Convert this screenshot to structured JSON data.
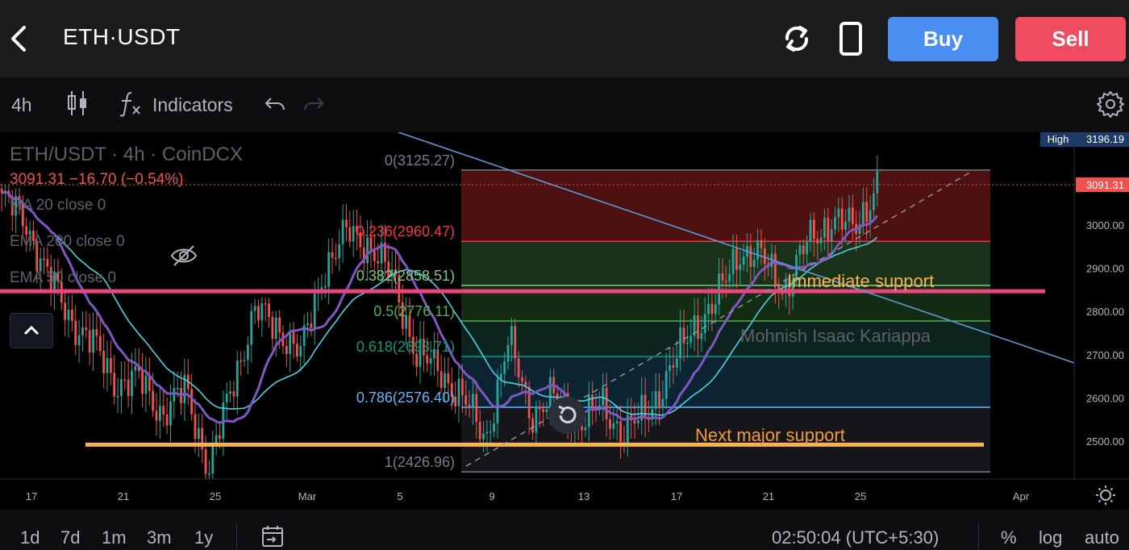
{
  "header": {
    "pair": "ETH·USDT",
    "buy_label": "Buy",
    "sell_label": "Sell"
  },
  "toolbar": {
    "interval": "4h",
    "indicators_label": "Indicators"
  },
  "legend": {
    "title": "ETH/USDT · 4h · CoinDCX",
    "price_line": "3091.31  −16.70 (−0.54%)",
    "indicators": [
      "MA 20 close 0",
      "EMA 200 close 0",
      "EMA 50 close 0"
    ]
  },
  "price_scale": {
    "high_label": "High",
    "high_value": "3196.19",
    "current_value": "3091.31",
    "ticks": [
      "3000.00",
      "2900.00",
      "2800.00",
      "2700.00",
      "2600.00",
      "2500.00"
    ]
  },
  "time_axis": {
    "ticks": [
      "17",
      "21",
      "25",
      "Mar",
      "5",
      "9",
      "13",
      "17",
      "21",
      "25",
      "Apr"
    ]
  },
  "fib_levels": [
    {
      "label": "0(3125.27)",
      "value": 3125.27,
      "color": "#787b86"
    },
    {
      "label": "0.236(2960.47)",
      "value": 2960.47,
      "color": "#f23645"
    },
    {
      "label": "0.382(2858.51)",
      "value": 2858.51,
      "color": "#81c784"
    },
    {
      "label": "0.5(2776.11)",
      "value": 2776.11,
      "color": "#4caf50"
    },
    {
      "label": "0.618(2693.71)",
      "value": 2693.71,
      "color": "#089981"
    },
    {
      "label": "0.786(2576.40)",
      "value": 2576.4,
      "color": "#64b5f6"
    },
    {
      "label": "1(2426.96)",
      "value": 2426.96,
      "color": "#787b86"
    }
  ],
  "annotations": {
    "immediate_support": "Immediate support",
    "next_support": "Next major support",
    "author": "Mohnish Isaac Kariappa"
  },
  "colors": {
    "up": "#26a69a",
    "down": "#ef5350",
    "ma20": "#7e57c2",
    "ema50": "#4dd0e1",
    "support_pink": "#e8467c",
    "support_orange": "#f7b254",
    "trendline": "#5b9bd5",
    "buy": "#4a8ef2",
    "sell": "#ef4d5f"
  },
  "chart_data": {
    "type": "candlestick",
    "symbol": "ETH/USDT",
    "interval": "4h",
    "last_price": 3091.31,
    "change": -16.7,
    "change_pct": -0.54,
    "high": 3196.19,
    "support_levels": [
      {
        "name": "Immediate support",
        "value": 2845
      },
      {
        "name": "Next major support",
        "value": 2490
      }
    ],
    "ylim": [
      2400,
      3220
    ],
    "close_path": [
      {
        "x": "Feb 15",
        "y": 3060
      },
      {
        "x": "Feb 16",
        "y": 3010
      },
      {
        "x": "Feb 17",
        "y": 2880
      },
      {
        "x": "Feb 18",
        "y": 2780
      },
      {
        "x": "Feb 19",
        "y": 2720
      },
      {
        "x": "Feb 20",
        "y": 2630
      },
      {
        "x": "Feb 21",
        "y": 2640
      },
      {
        "x": "Feb 22",
        "y": 2560
      },
      {
        "x": "Feb 23",
        "y": 2620
      },
      {
        "x": "Feb 24",
        "y": 2430
      },
      {
        "x": "Feb 25",
        "y": 2630
      },
      {
        "x": "Feb 26",
        "y": 2800
      },
      {
        "x": "Feb 27",
        "y": 2760
      },
      {
        "x": "Feb 28",
        "y": 2700
      },
      {
        "x": "Mar 1",
        "y": 2900
      },
      {
        "x": "Mar 2",
        "y": 2980
      },
      {
        "x": "Mar 3",
        "y": 2950
      },
      {
        "x": "Mar 4",
        "y": 2870
      },
      {
        "x": "Mar 5",
        "y": 2700
      },
      {
        "x": "Mar 6",
        "y": 2660
      },
      {
        "x": "Mar 7",
        "y": 2600
      },
      {
        "x": "Mar 8",
        "y": 2500
      },
      {
        "x": "Mar 9",
        "y": 2730
      },
      {
        "x": "Mar 10",
        "y": 2560
      },
      {
        "x": "Mar 11",
        "y": 2600
      },
      {
        "x": "Mar 12",
        "y": 2540
      },
      {
        "x": "Mar 13",
        "y": 2580
      },
      {
        "x": "Mar 14",
        "y": 2520
      },
      {
        "x": "Mar 15",
        "y": 2560
      },
      {
        "x": "Mar 16",
        "y": 2660
      },
      {
        "x": "Mar 17",
        "y": 2760
      },
      {
        "x": "Mar 18",
        "y": 2820
      },
      {
        "x": "Mar 19",
        "y": 2940
      },
      {
        "x": "Mar 20",
        "y": 2920
      },
      {
        "x": "Mar 21",
        "y": 2850
      },
      {
        "x": "Mar 22",
        "y": 2960
      },
      {
        "x": "Mar 23",
        "y": 3010
      },
      {
        "x": "Mar 24",
        "y": 2990
      },
      {
        "x": "Mar 25",
        "y": 3091
      }
    ]
  }
}
